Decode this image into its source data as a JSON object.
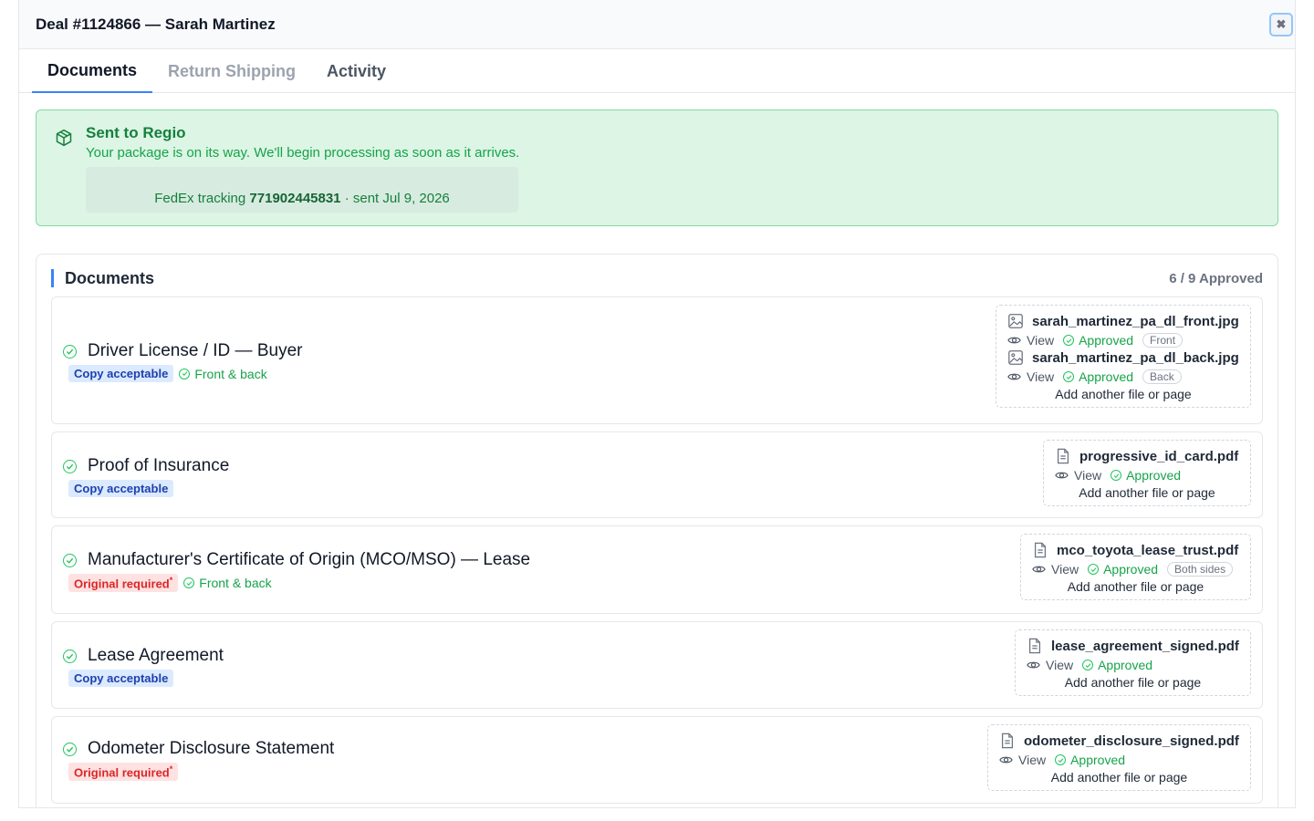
{
  "header": {
    "title": "Deal #1124866 — Sarah Martinez",
    "close_icon": "close-icon"
  },
  "tabs": [
    {
      "label": "Documents",
      "state": "active"
    },
    {
      "label": "Return Shipping",
      "state": "disabled"
    },
    {
      "label": "Activity",
      "state": "normal"
    }
  ],
  "banner": {
    "title": "Sent to Regio",
    "subtitle": "Your package is on its way. We'll begin processing as soon as it arrives.",
    "tracking_prefix": "FedEx tracking",
    "tracking_number": "771902445831",
    "tracking_suffix": "· sent Jul 9, 2026",
    "icon": "package-icon",
    "bg_color": "#dcf5e4"
  },
  "documents": {
    "title": "Documents",
    "count": "6 / 9 Approved",
    "items": [
      {
        "name": "Driver License / ID — Buyer",
        "tag": "Copy acceptable",
        "note": "Front & back",
        "files": [
          {
            "name": "sarah_martinez_pa_dl_front.jpg",
            "view": "View",
            "status": "Approved",
            "side": "Front"
          },
          {
            "name": "sarah_martinez_pa_dl_back.jpg",
            "view": "View",
            "status": "Approved",
            "side": "Back"
          }
        ],
        "add": "Add another file or page"
      },
      {
        "name": "Proof of Insurance",
        "tag": "Copy acceptable",
        "files": [
          {
            "name": "progressive_id_card.pdf",
            "view": "View",
            "status": "Approved"
          }
        ],
        "add": "Add another file or page"
      },
      {
        "name": "Manufacturer's Certificate of Origin (MCO/MSO) — Lease",
        "tag": "Original required",
        "note": "Front & back",
        "files": [
          {
            "name": "mco_toyota_lease_trust.pdf",
            "view": "View",
            "status": "Approved",
            "side": "Both sides"
          }
        ],
        "add": "Add another file or page"
      },
      {
        "name": "Lease Agreement",
        "tag": "Copy acceptable",
        "files": [
          {
            "name": "lease_agreement_signed.pdf",
            "view": "View",
            "status": "Approved"
          }
        ],
        "add": "Add another file or page"
      },
      {
        "name": "Odometer Disclosure Statement",
        "tag": "Original required",
        "files": [
          {
            "name": "odometer_disclosure_signed.pdf",
            "view": "View",
            "status": "Approved"
          }
        ],
        "add": "Add another file or page"
      }
    ]
  }
}
